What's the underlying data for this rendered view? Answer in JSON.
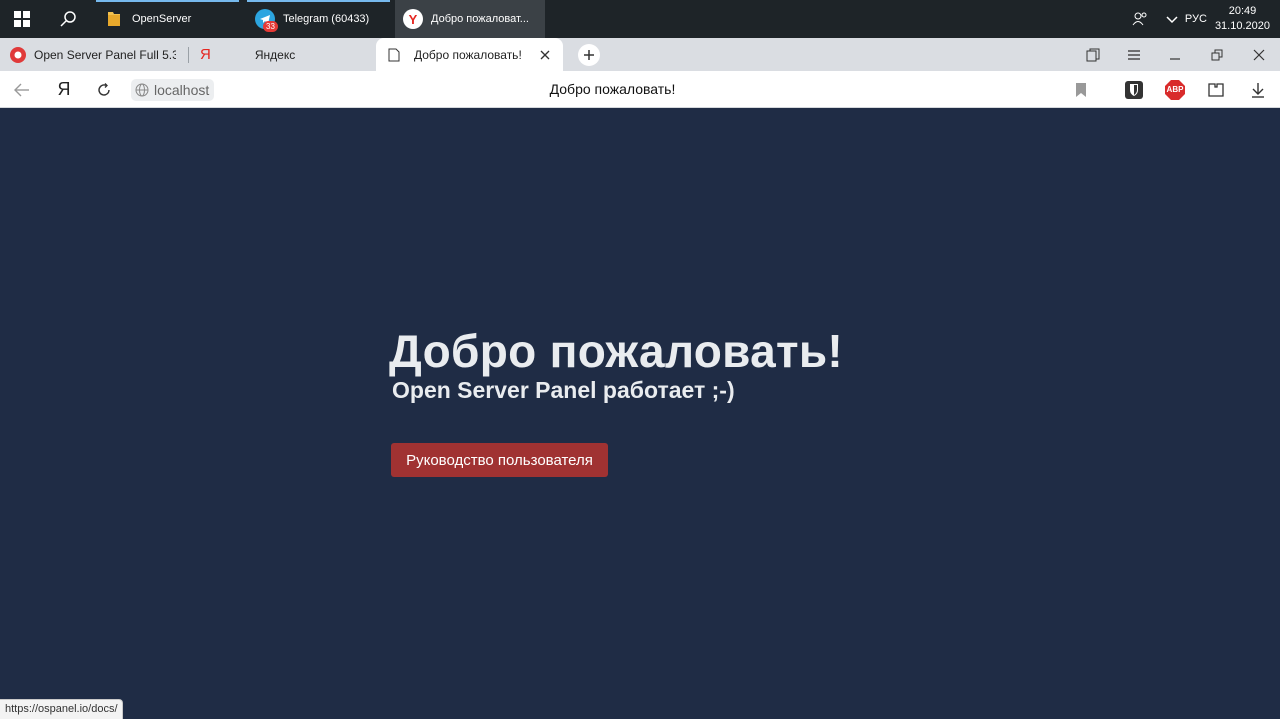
{
  "taskbar": {
    "apps": [
      {
        "label": "OpenServer",
        "icon": "folder-icon"
      },
      {
        "label": "Telegram (60433)",
        "icon": "telegram-icon",
        "badge": "33"
      },
      {
        "label": "Добро пожаловат...",
        "icon": "yandex-browser-icon"
      }
    ],
    "language": "РУС",
    "time": "20:49",
    "date": "31.10.2020"
  },
  "browser": {
    "tabs": [
      {
        "label": "Open Server Panel Full 5.3.",
        "icon": "opera-red-icon"
      },
      {
        "label": "Яндекс",
        "icon": "yandex-icon"
      },
      {
        "label": "Добро пожаловать!",
        "icon": "page-icon",
        "active": true
      }
    ],
    "address": {
      "host": "localhost",
      "yandex_letter": "Я",
      "center_title": "Добро пожаловать!"
    },
    "extensions": {
      "abp_label": "ABP"
    },
    "status_url": "https://ospanel.io/docs/"
  },
  "page": {
    "title": "Добро пожаловать!",
    "subtitle": "Open Server Panel работает ;-)",
    "docs_button": "Руководство пользователя"
  },
  "colors": {
    "page_bg": "#1f2c45",
    "button_bg": "#a03232",
    "taskbar_bg": "#1e2428",
    "tabstrip_bg": "#dadde2"
  }
}
